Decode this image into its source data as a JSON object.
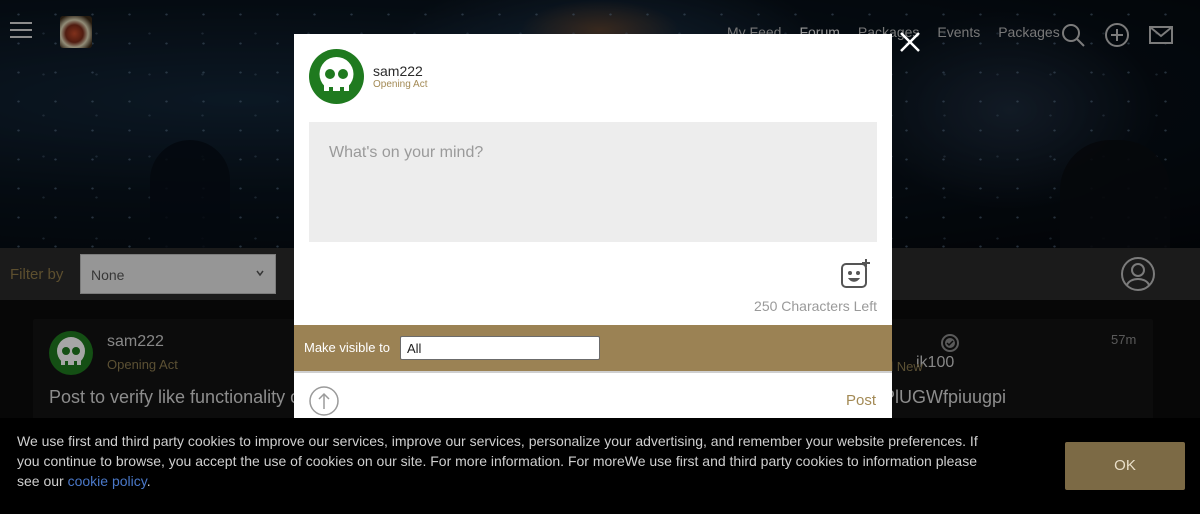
{
  "nav": {
    "links": [
      "My Feed",
      "Forum",
      "Packages",
      "Events",
      "Packages"
    ],
    "active_index": 1,
    "icons": [
      "search-icon",
      "add-circle-icon",
      "mail-icon"
    ]
  },
  "filter": {
    "label": "Filter by",
    "value": "None"
  },
  "feed": {
    "post1": {
      "username": "sam222",
      "rank": "Opening Act",
      "text": "Post to verify like functionality o"
    },
    "post2": {
      "username": "ik100",
      "rank": "al New",
      "text": "PlUGWfpiuugpi",
      "time": "57m"
    }
  },
  "modal": {
    "username": "sam222",
    "rank": "Opening Act",
    "placeholder": "What's on your mind?",
    "chars_left": "250 Characters Left",
    "visibility_label": "Make visible to",
    "visibility_value": "All",
    "post_label": "Post"
  },
  "cookie": {
    "text": "We use first and third party cookies to improve our services, improve our services, personalize your advertising, and remember your website preferences. If you continue to browse, you accept the use of cookies on our site. For more information. For moreWe use first and third party cookies to information please see our",
    "link": "cookie policy",
    "tail": ".",
    "ok_label": "OK"
  },
  "colors": {
    "accent_gold": "#9b8254",
    "avatar_green": "#1f7a1f"
  }
}
